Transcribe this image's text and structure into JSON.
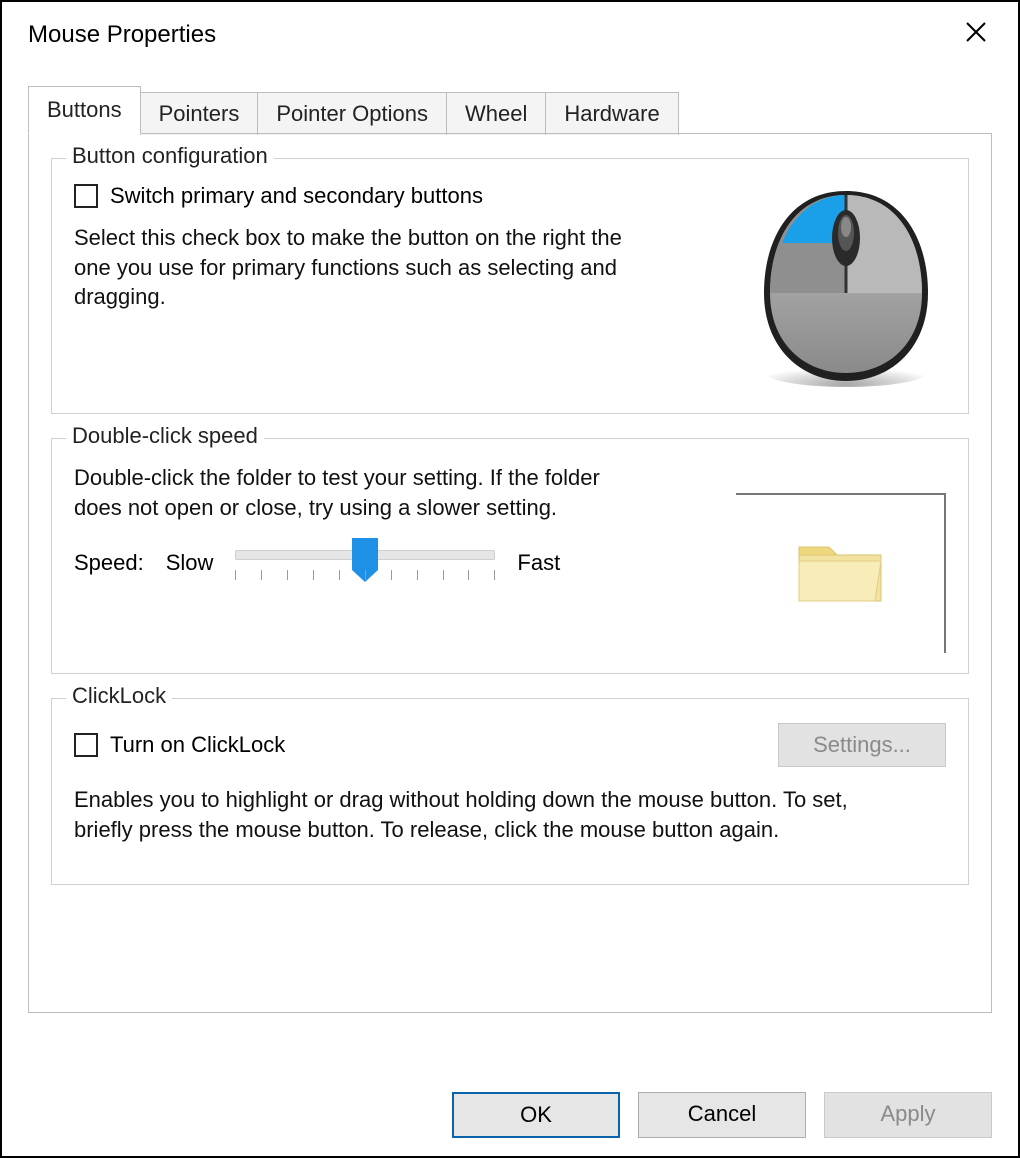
{
  "window": {
    "title": "Mouse Properties"
  },
  "tabs": [
    {
      "label": "Buttons",
      "active": true
    },
    {
      "label": "Pointers",
      "active": false
    },
    {
      "label": "Pointer Options",
      "active": false
    },
    {
      "label": "Wheel",
      "active": false
    },
    {
      "label": "Hardware",
      "active": false
    }
  ],
  "button_config": {
    "title": "Button configuration",
    "checkbox_label": "Switch primary and secondary buttons",
    "checked": false,
    "description": "Select this check box to make the button on the right the one you use for primary functions such as selecting and dragging."
  },
  "double_click": {
    "title": "Double-click speed",
    "description": "Double-click the folder to test your setting. If the folder does not open or close, try using a slower setting.",
    "speed_label": "Speed:",
    "slow_label": "Slow",
    "fast_label": "Fast",
    "slider_min": 0,
    "slider_max": 10,
    "slider_value": 5
  },
  "clicklock": {
    "title": "ClickLock",
    "checkbox_label": "Turn on ClickLock",
    "checked": false,
    "settings_button": "Settings...",
    "settings_enabled": false,
    "description": "Enables you to highlight or drag without holding down the mouse button. To set, briefly press the mouse button. To release, click the mouse button again."
  },
  "footer": {
    "ok": "OK",
    "cancel": "Cancel",
    "apply": "Apply",
    "apply_enabled": false
  }
}
